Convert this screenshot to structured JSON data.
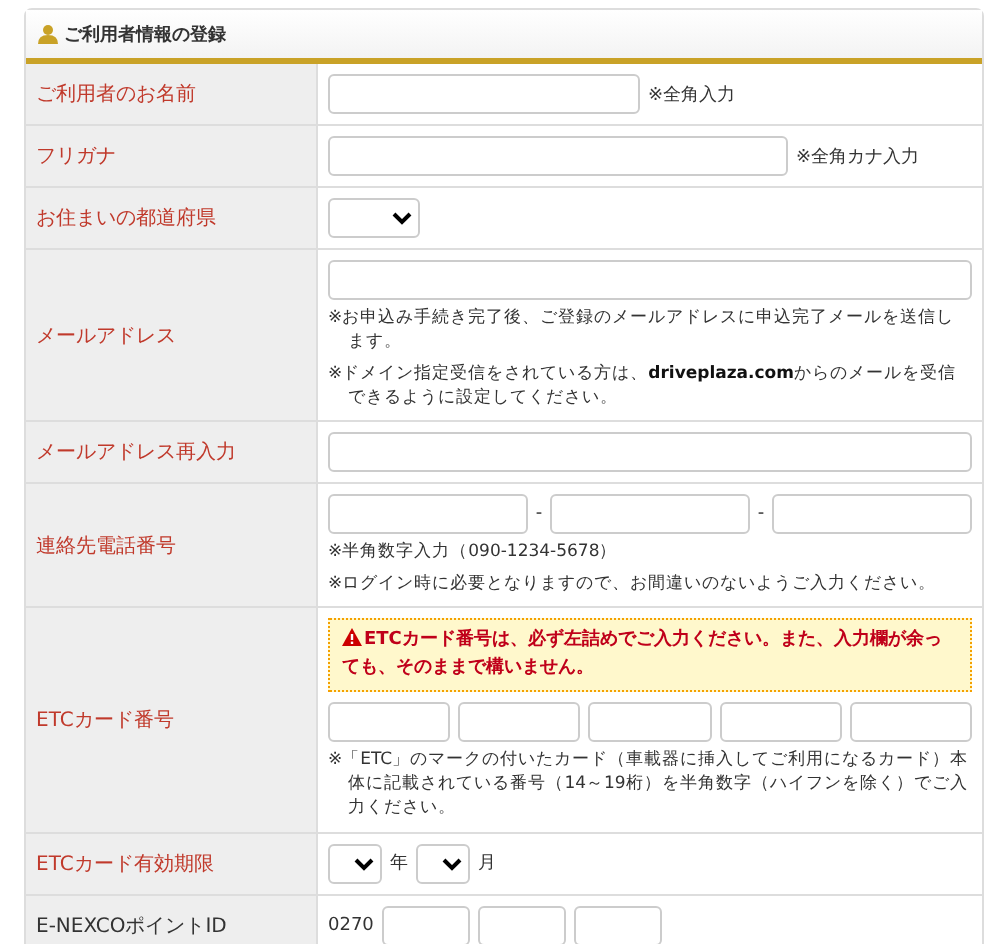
{
  "section": {
    "title": "ご利用者情報の登録"
  },
  "rows": [
    {
      "label": "ご利用者のお名前",
      "required": true,
      "kind": "shortfield",
      "inline_note": "※全角入力"
    },
    {
      "label": "フリガナ",
      "required": true,
      "kind": "mediumfield",
      "inline_note": "※全角カナ入力"
    },
    {
      "label": "お住まいの都道府県",
      "required": true,
      "kind": "select"
    },
    {
      "label": "メールアドレス",
      "required": true,
      "kind": "widefield",
      "notes": [
        "※お申込み手続き完了後、ご登録のメールアドレスに申込完了メールを送信します。",
        "※ドメイン指定受信をされている方は、**driveplaza.com**からのメールを受信できるように設定してください。"
      ]
    },
    {
      "label": "メールアドレス再入力",
      "required": true,
      "kind": "widefield"
    },
    {
      "label": "連絡先電話番号",
      "required": true,
      "kind": "phone",
      "separators": [
        "-",
        "-"
      ],
      "notes": [
        "※半角数字入力（090-1234-5678）",
        "※ログイン時に必要となりますので、お間違いのないようご入力ください。"
      ]
    },
    {
      "label": "ETCカード番号",
      "required": true,
      "kind": "cardnumber",
      "warning": "ETCカード番号は、必ず左詰めでご入力ください。また、入力欄が余っても、そのままで構いません。",
      "notes": [
        "※「ETC」のマークの付いたカード（車載器に挿入してご利用になるカード）本体に記載されている番号（14～19桁）を半角数字（ハイフンを除く）でご入力ください。"
      ]
    },
    {
      "label": "ETCカード有効期限",
      "required": true,
      "kind": "date",
      "parts": [
        {
          "unit": "年"
        },
        {
          "unit": "月"
        }
      ]
    },
    {
      "label": "E-NEXCOポイントID",
      "required": false,
      "kind": "pointid",
      "prefix": "0270"
    }
  ]
}
